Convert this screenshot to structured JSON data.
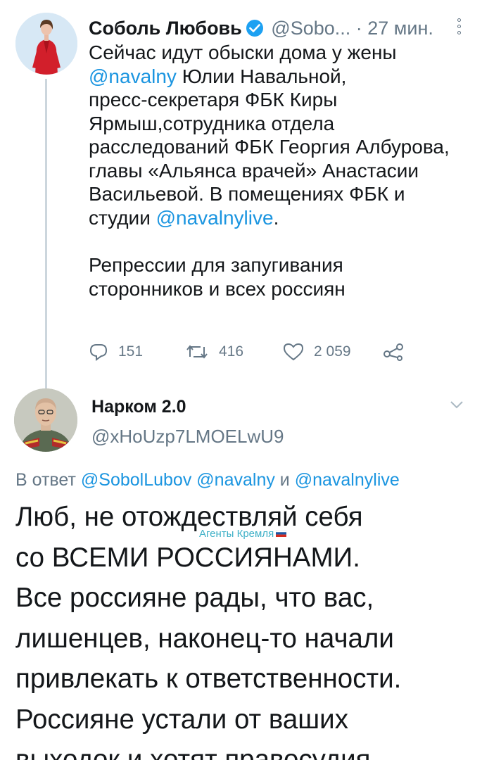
{
  "tweet1": {
    "name": "Соболь Любовь",
    "handle": "@Sobo...",
    "time": "· 27 мин.",
    "body": {
      "l1": "Сейчас идут обыски дома у жены",
      "l2_link": "@navalny",
      "l2_text": " Юлии Навальной,",
      "l3": "пресс-секретаря ФБК Киры",
      "l4": "Ярмыш,сотрудника отдела",
      "l5": "расследований ФБК Георгия Албурова,",
      "l6": "главы «Альянса врачей» Анастасии",
      "l7": "Васильевой. В помещениях ФБК и",
      "l8_text": "студии ",
      "l8_link": "@navalnylive",
      "l8_end": ".",
      "p2_l1": "Репрессии для запугивания",
      "p2_l2": "сторонников и всех россиян"
    },
    "actions": {
      "replies": "151",
      "retweets": "416",
      "likes": "2 059"
    },
    "icons": [
      "verified-icon",
      "more-icon",
      "reply-icon",
      "retweet-icon",
      "like-icon",
      "share-icon"
    ]
  },
  "tweet2": {
    "name": "Нарком 2.0",
    "handle": "@xHoUzp7LMOELwU9",
    "reply_prefix": "В ответ ",
    "reply_mention1": "@SobolLubov",
    "reply_mention2": "@navalny",
    "reply_and": " и ",
    "reply_mention3": "@navalnylive",
    "body": {
      "l1": "Люб, не отождествляй себя",
      "l2": "со ВСЕМИ РОССИЯНАМИ.",
      "l3": "Все россияне рады, что вас,",
      "l4": "лишенцев, наконец-то начали",
      "l5": "привлекать к ответственности.",
      "l6": "Россияне устали от ваших",
      "l7": "выходок и хотят правосудия."
    }
  },
  "watermark": "Агенты Кремля",
  "colors": {
    "link": "#1b95e0",
    "muted": "#657786",
    "verified": "#1da1f2",
    "watermark": "#3eb0c7"
  }
}
